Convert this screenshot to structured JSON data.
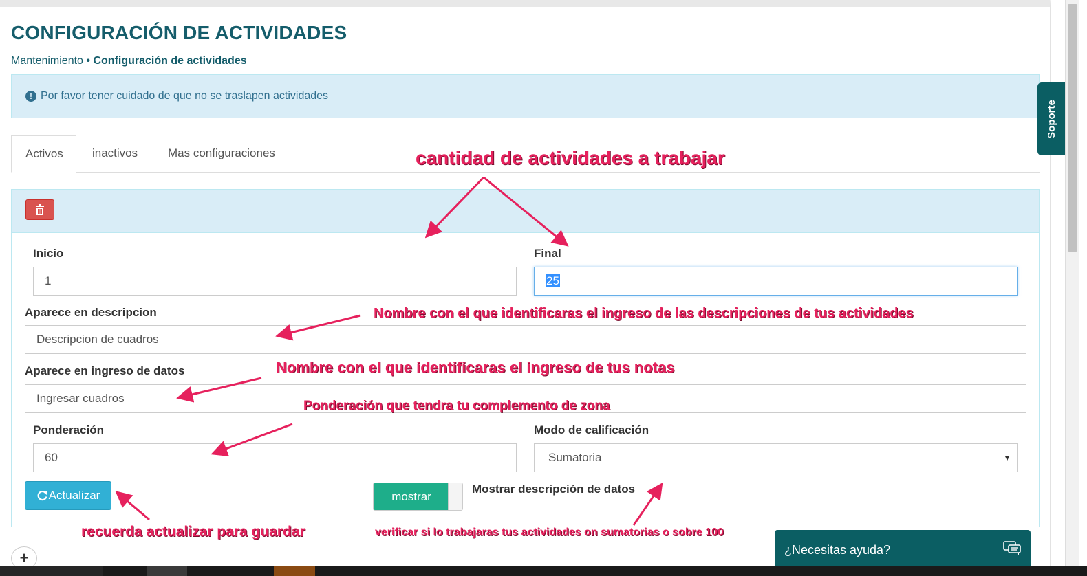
{
  "page": {
    "title": "CONFIGURACIÓN DE ACTIVIDADES",
    "breadcrumb": {
      "link": "Mantenimiento",
      "separator": "•",
      "current": "Configuración de actividades"
    }
  },
  "alert": {
    "icon": "info-circle-icon",
    "text": "Por favor tener cuidado de que no se traslapen actividades"
  },
  "tabs": [
    {
      "label": "Activos",
      "active": true
    },
    {
      "label": "inactivos",
      "active": false
    },
    {
      "label": "Mas configuraciones",
      "active": false
    }
  ],
  "form": {
    "delete_icon": "trash-icon",
    "inicio_label": "Inicio",
    "inicio_value": "1",
    "final_label": "Final",
    "final_value": "25",
    "descripcion_label": "Aparece en descripcion",
    "descripcion_value": "Descripcion de cuadros",
    "ingreso_label": "Aparece en ingreso de datos",
    "ingreso_value": "Ingresar cuadros",
    "ponderacion_label": "Ponderación",
    "ponderacion_value": "60",
    "modo_label": "Modo de calificación",
    "modo_value": "Sumatoria",
    "update_label": "Actualizar",
    "toggle_label": "mostrar",
    "toggle_on": true,
    "toggle_caption": "Mostrar descripción de datos"
  },
  "annotations": {
    "cantidad": "cantidad de actividades a trabajar",
    "nombre_desc": "Nombre con el que identificaras el ingreso de las descripciones de tus actividades",
    "nombre_notas": "Nombre con el que identificaras el ingreso de tus notas",
    "ponderacion": "Ponderación que tendra tu complemento de zona",
    "recuerda": "recuerda actualizar para guardar",
    "verificar": "verificar si lo trabajaras tus actividades on sumatorias o sobre 100"
  },
  "support": {
    "label": "Soporte"
  },
  "help": {
    "label": "¿Necesitas ayuda?",
    "icon": "chat-bubbles-icon"
  },
  "colors": {
    "primary": "#155d6b",
    "info_bg": "#d9edf7",
    "danger": "#d9534f",
    "info_btn": "#31b0d5",
    "toggle_on": "#1eae8a",
    "annotation": "#e6215d",
    "support": "#0b5e63"
  }
}
